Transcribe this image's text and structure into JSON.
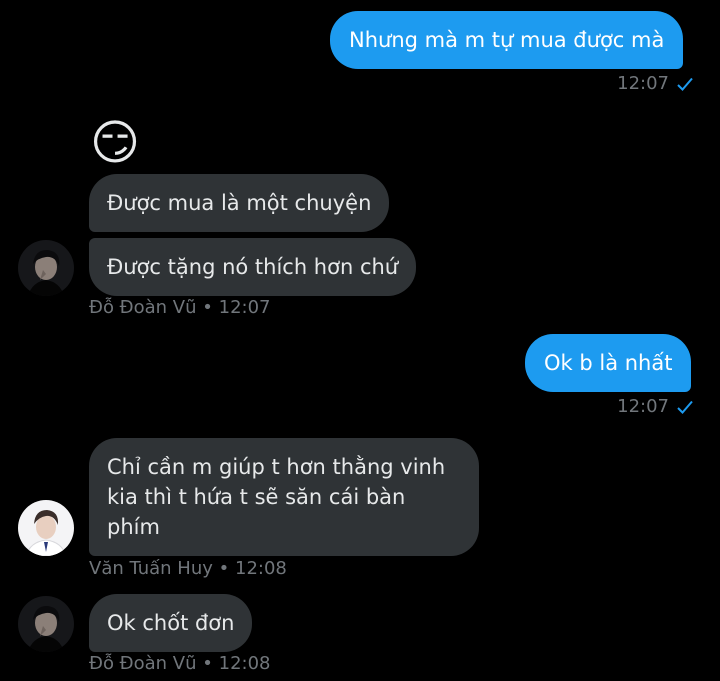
{
  "messages": {
    "m1": {
      "text": "Nhưng mà m tự mua được mà",
      "time": "12:07"
    },
    "m2": {
      "emoji": "😏"
    },
    "m3": {
      "text": "Được mua là một chuyện"
    },
    "m4": {
      "text": "Được tặng nó thích hơn chứ"
    },
    "meta1": {
      "sender": "Đỗ Đoàn Vũ",
      "time": "12:07"
    },
    "m5": {
      "text": "Ok b là nhất",
      "time": "12:07"
    },
    "m6": {
      "line1": "Chỉ cần m giúp t hơn thằng vinh",
      "line2": "kia thì t hứa t sẽ săn cái bàn",
      "line3": "phím"
    },
    "meta2": {
      "sender": "Văn Tuấn Huy",
      "time": "12:08"
    },
    "m7": {
      "text": "Ok chốt đơn"
    },
    "meta3": {
      "sender": "Đỗ Đoàn Vũ",
      "time": "12:08"
    }
  },
  "separator": "•",
  "icons": {
    "read_receipt": "check-icon",
    "accent": "#1d9bf0"
  }
}
